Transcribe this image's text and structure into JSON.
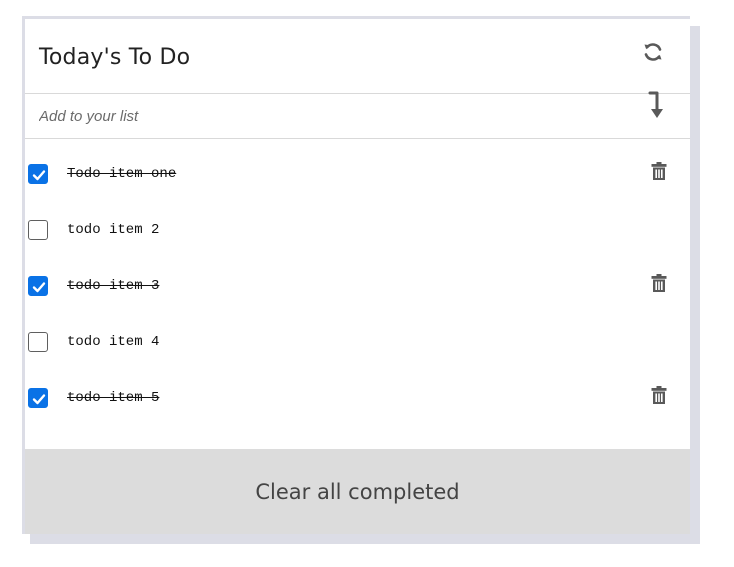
{
  "header": {
    "title": "Today's To Do",
    "refresh_icon": "refresh-icon"
  },
  "add": {
    "placeholder": "Add to your list",
    "value": "",
    "enter_icon": "enter-arrow-icon"
  },
  "todos": [
    {
      "text": "Todo item one",
      "completed": true
    },
    {
      "text": "todo item 2",
      "completed": false
    },
    {
      "text": "todo item 3",
      "completed": true
    },
    {
      "text": "todo item 4",
      "completed": false
    },
    {
      "text": "todo item 5",
      "completed": true
    }
  ],
  "footer": {
    "clear_label": "Clear all completed"
  },
  "colors": {
    "accent": "#0a72e6",
    "footer_bg": "#dcdcdc",
    "icon": "#595959",
    "shadow": "#dcdde6"
  }
}
